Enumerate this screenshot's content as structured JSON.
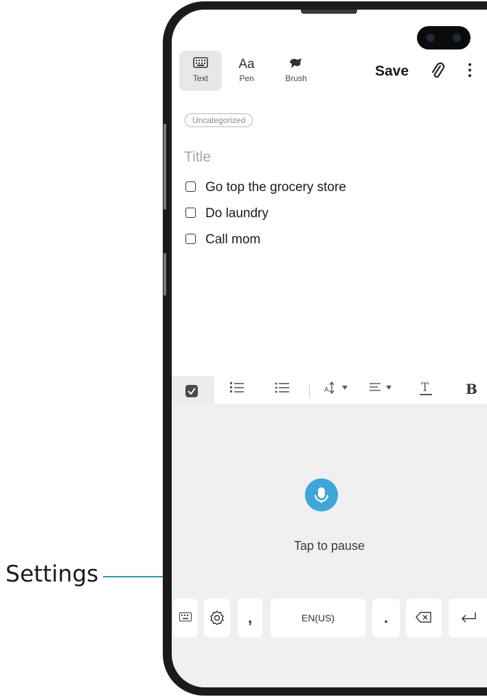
{
  "callout": {
    "label": "Settings"
  },
  "toolbar": {
    "items": [
      {
        "label": "Text",
        "icon": "keyboard-icon",
        "active": true
      },
      {
        "label": "Pen",
        "icon": "pen-text-icon",
        "glyph": "Aa"
      },
      {
        "label": "Brush",
        "icon": "brush-icon"
      }
    ],
    "save_label": "Save"
  },
  "note": {
    "category": "Uncategorized",
    "title_placeholder": "Title",
    "checklist": [
      "Go top the grocery store",
      "Do laundry",
      "Call mom"
    ]
  },
  "format_bar": {
    "bold_label": "B"
  },
  "voice": {
    "status": "Tap to pause",
    "accent_color": "#3ea7d9"
  },
  "keyboard": {
    "comma": ",",
    "language": "EN(US)",
    "period": "."
  }
}
